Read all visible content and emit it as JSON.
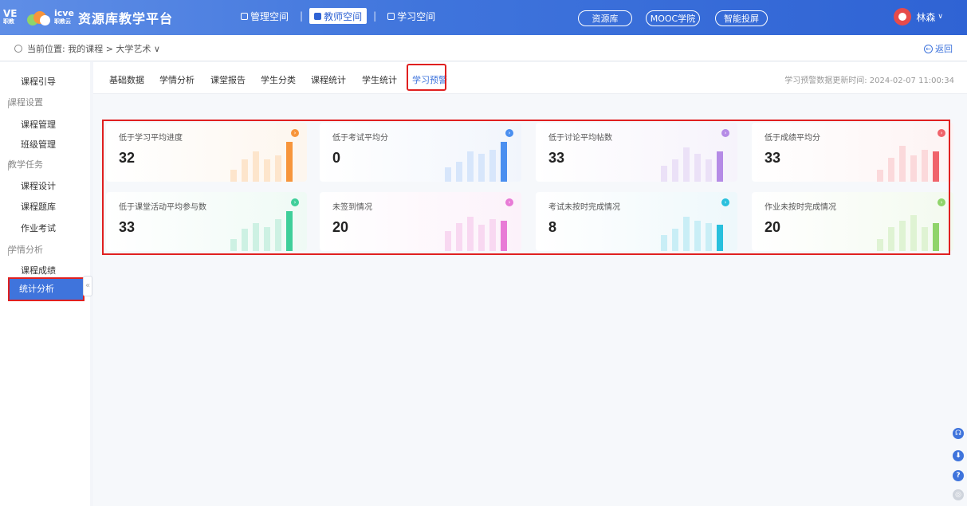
{
  "header": {
    "logo_small": "VE",
    "logo_small_sub": "职教",
    "logo_icve": "icve",
    "logo_icve_sub": "职教云",
    "title": "资源库教学平台",
    "spaces": [
      {
        "label": "管理空间",
        "active": false
      },
      {
        "label": "教师空间",
        "active": true
      },
      {
        "label": "学习空间",
        "active": false
      }
    ],
    "pills": [
      "资源库",
      "MOOC学院",
      "智能投屏"
    ],
    "user_name": "林森",
    "user_caret": "∨"
  },
  "breadcrumb": {
    "text": "当前位置: 我的课程 > 大学艺术 ∨",
    "back": "返回"
  },
  "sidebar": {
    "items": [
      {
        "label": "课程引导",
        "type": "item"
      },
      {
        "label": "课程设置",
        "type": "group"
      },
      {
        "label": "课程管理",
        "type": "item"
      },
      {
        "label": "班级管理",
        "type": "item"
      },
      {
        "label": "教学任务",
        "type": "group"
      },
      {
        "label": "课程设计",
        "type": "item"
      },
      {
        "label": "课程题库",
        "type": "item"
      },
      {
        "label": "作业考试",
        "type": "item"
      },
      {
        "label": "学情分析",
        "type": "group"
      },
      {
        "label": "课程成绩",
        "type": "item"
      },
      {
        "label": "统计分析",
        "type": "active"
      }
    ],
    "collapse": "«"
  },
  "tabs": {
    "items": [
      "基础数据",
      "学情分析",
      "课堂报告",
      "学生分类",
      "课程统计",
      "学生统计",
      "学习预警"
    ],
    "active_index": 6,
    "update_time": "学习预警数据更新时间: 2024-02-07 11:00:34"
  },
  "cards": [
    {
      "title": "低于学习平均进度",
      "value": "32",
      "color": "#f7953b",
      "bg": "#fdf6ee",
      "bar_light": "#fde5cc"
    },
    {
      "title": "低于考试平均分",
      "value": "0",
      "color": "#4a8ff0",
      "bg": "#f1f5fc",
      "bar_light": "#d7e6fb"
    },
    {
      "title": "低于讨论平均帖数",
      "value": "33",
      "color": "#b58be6",
      "bg": "#f6f3fb",
      "bar_light": "#ebe1f7"
    },
    {
      "title": "低于成绩平均分",
      "value": "33",
      "color": "#f0636b",
      "bg": "#fdf3f3",
      "bar_light": "#fbd9db"
    },
    {
      "title": "低于课堂活动平均参与数",
      "value": "33",
      "color": "#3fcf9a",
      "bg": "#effaf5",
      "bar_light": "#cdf1e3"
    },
    {
      "title": "未签到情况",
      "value": "20",
      "color": "#e87bd6",
      "bg": "#fcf2fa",
      "bar_light": "#f8d8f1"
    },
    {
      "title": "考试未按时完成情况",
      "value": "8",
      "color": "#29c0dd",
      "bg": "#eef8fb",
      "bar_light": "#c9eef6"
    },
    {
      "title": "作业未按时完成情况",
      "value": "20",
      "color": "#8fd46a",
      "bg": "#f3faef",
      "bar_light": "#dff3d3"
    }
  ],
  "tools": [
    {
      "icon": "headset-icon",
      "color": "#3f74dc"
    },
    {
      "icon": "download-icon",
      "color": "#3f74dc"
    },
    {
      "icon": "help-icon",
      "color": "#3f74dc"
    },
    {
      "icon": "settings-icon",
      "color": "#cfd4dc"
    }
  ],
  "tool_glyphs": [
    "☊",
    "⬇",
    "?",
    "◎"
  ]
}
